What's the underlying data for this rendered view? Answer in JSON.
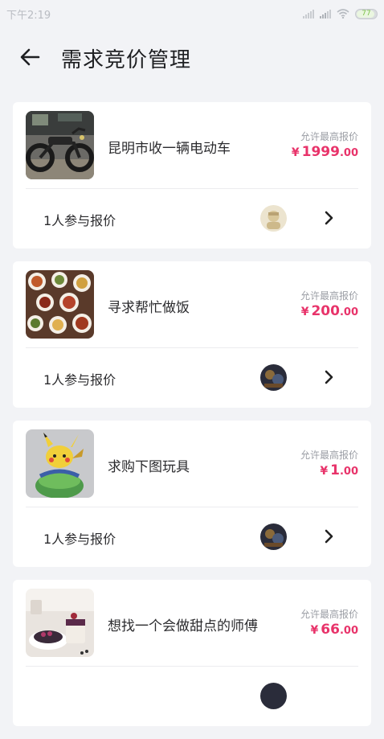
{
  "status_bar": {
    "time": "下午2:19",
    "battery": "77"
  },
  "header": {
    "title": "需求竞价管理"
  },
  "requests": [
    {
      "title": "昆明市收一辆电动车",
      "price_label": "允许最高报价",
      "currency": "¥",
      "price_int": "1999",
      "price_dec": ".00",
      "bid_count": "1人参与报价",
      "image": "electric-scooter-photo",
      "avatar": "light-avatar"
    },
    {
      "title": "寻求帮忙做饭",
      "price_label": "允许最高报价",
      "currency": "¥",
      "price_int": "200",
      "price_dec": ".00",
      "bid_count": "1人参与报价",
      "image": "dishes-photo",
      "avatar": "dark-avatar"
    },
    {
      "title": "求购下图玩具",
      "price_label": "允许最高报价",
      "currency": "¥",
      "price_int": "1",
      "price_dec": ".00",
      "bid_count": "1人参与报价",
      "image": "pikachu-toy-photo",
      "avatar": "dark-avatar"
    },
    {
      "title": "想找一个会做甜点的师傅",
      "price_label": "允许最高报价",
      "currency": "¥",
      "price_int": "66",
      "price_dec": ".00",
      "bid_count": "",
      "image": "desserts-photo",
      "avatar": "dark-avatar"
    }
  ]
}
